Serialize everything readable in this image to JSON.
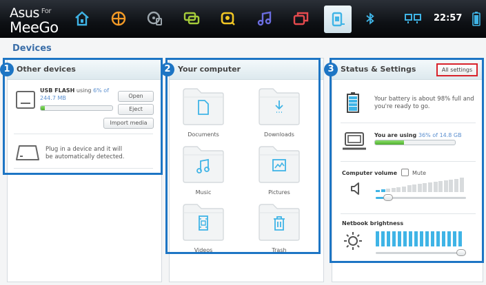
{
  "brand": {
    "name_line1": "Asus",
    "for": "For",
    "name_line2": "MeeGo"
  },
  "topbar": {
    "zones": [
      {
        "icon": "home-icon",
        "color": "#3fb4e6"
      },
      {
        "icon": "web-globe-icon",
        "color": "#f39a26"
      },
      {
        "icon": "media-disc-icon",
        "color": "#9ca6ad"
      },
      {
        "icon": "friends-chat-icon",
        "color": "#a5cc3a"
      },
      {
        "icon": "people-icon",
        "color": "#f1c624"
      },
      {
        "icon": "music-note-icon",
        "color": "#6b6de0"
      },
      {
        "icon": "windows-apps-icon",
        "color": "#e64a4e"
      },
      {
        "icon": "devices-icon",
        "color": "#3fb4e6"
      }
    ],
    "clock": "22:57"
  },
  "page_title": "Devices",
  "other_devices": {
    "badge": "1",
    "title": "Other devices",
    "usb_name": "USB FLASH",
    "usb_using_word": " using ",
    "usb_percent": "6% of",
    "usb_size": "244.7 MB",
    "usb_fill": 0.06,
    "open_label": "Open",
    "eject_label": "Eject",
    "import_label": "Import media",
    "plug_line1": "Plug in a device and it will",
    "plug_line2": "be automatically detected."
  },
  "your_computer": {
    "badge": "2",
    "title": "Your computer",
    "folders": [
      {
        "label": "Documents",
        "icon": "document-icon"
      },
      {
        "label": "Downloads",
        "icon": "download-icon"
      },
      {
        "label": "Music",
        "icon": "music-icon"
      },
      {
        "label": "Pictures",
        "icon": "picture-icon"
      },
      {
        "label": "Videos",
        "icon": "video-icon"
      },
      {
        "label": "Trash",
        "icon": "trash-icon"
      }
    ]
  },
  "status": {
    "badge": "3",
    "title": "Status & Settings",
    "all_settings_label": "All settings",
    "battery_line1": "Your battery is about 98% full and",
    "battery_line2": "you're ready to go.",
    "using_prefix": "You are using ",
    "using_value": "36% of 14.8 GB",
    "disk_fill": 0.36,
    "volume_label": "Computer volume",
    "mute_label": "Mute",
    "volume_level": 0.1,
    "brightness_label": "Netbook brightness",
    "brightness_level": 1.0,
    "accent_color": "#3fb4e6"
  }
}
